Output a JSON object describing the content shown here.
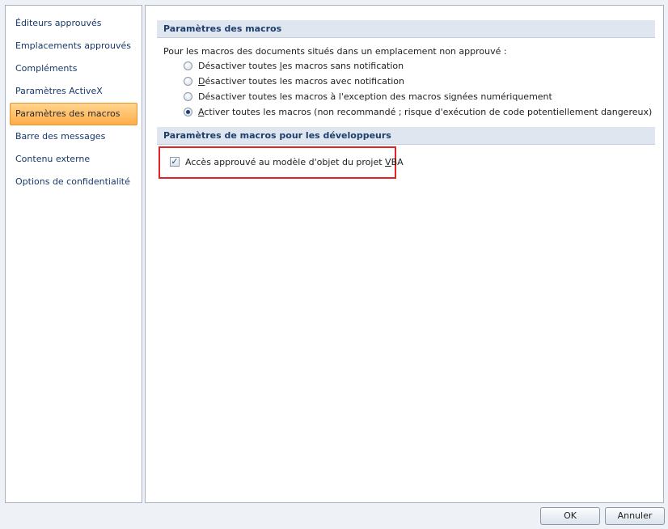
{
  "sidebar": {
    "items": [
      {
        "label": "Éditeurs approuvés",
        "selected": false
      },
      {
        "label": "Emplacements approuvés",
        "selected": false
      },
      {
        "label": "Compléments",
        "selected": false
      },
      {
        "label": "Paramètres ActiveX",
        "selected": false
      },
      {
        "label": "Paramètres des macros",
        "selected": true
      },
      {
        "label": "Barre des messages",
        "selected": false
      },
      {
        "label": "Contenu externe",
        "selected": false
      },
      {
        "label": "Options de confidentialité",
        "selected": false
      }
    ]
  },
  "macro_settings": {
    "header": "Paramètres des macros",
    "intro": "Pour les macros des documents situés dans un emplacement non approuvé :",
    "options": [
      {
        "pre": "Désactiver toutes ",
        "key": "l",
        "post": "es macros sans notification",
        "checked": false
      },
      {
        "pre": "",
        "key": "D",
        "post": "ésactiver toutes les macros avec notification",
        "checked": false
      },
      {
        "pre": "Désactiver toutes les macros à l'exception des macros si",
        "key": "g",
        "post": "nées numériquement",
        "checked": false
      },
      {
        "pre": "",
        "key": "A",
        "post": "ctiver toutes les macros (non recommandé ; risque d'exécution de code potentiellement dangereux)",
        "checked": true
      }
    ]
  },
  "developer_settings": {
    "header": "Paramètres de macros pour les développeurs",
    "vba_access": {
      "pre": "Accès approuvé au modèle d'objet du projet ",
      "key": "V",
      "post": "BA",
      "checked": true
    }
  },
  "footer": {
    "ok_label": "OK",
    "cancel_label": "Annuler"
  },
  "icons": {
    "checkmark": "✓"
  },
  "colors": {
    "selected_item": "#ffad4a",
    "highlight_border": "#e12326",
    "header_background": "#dfe6ef"
  }
}
